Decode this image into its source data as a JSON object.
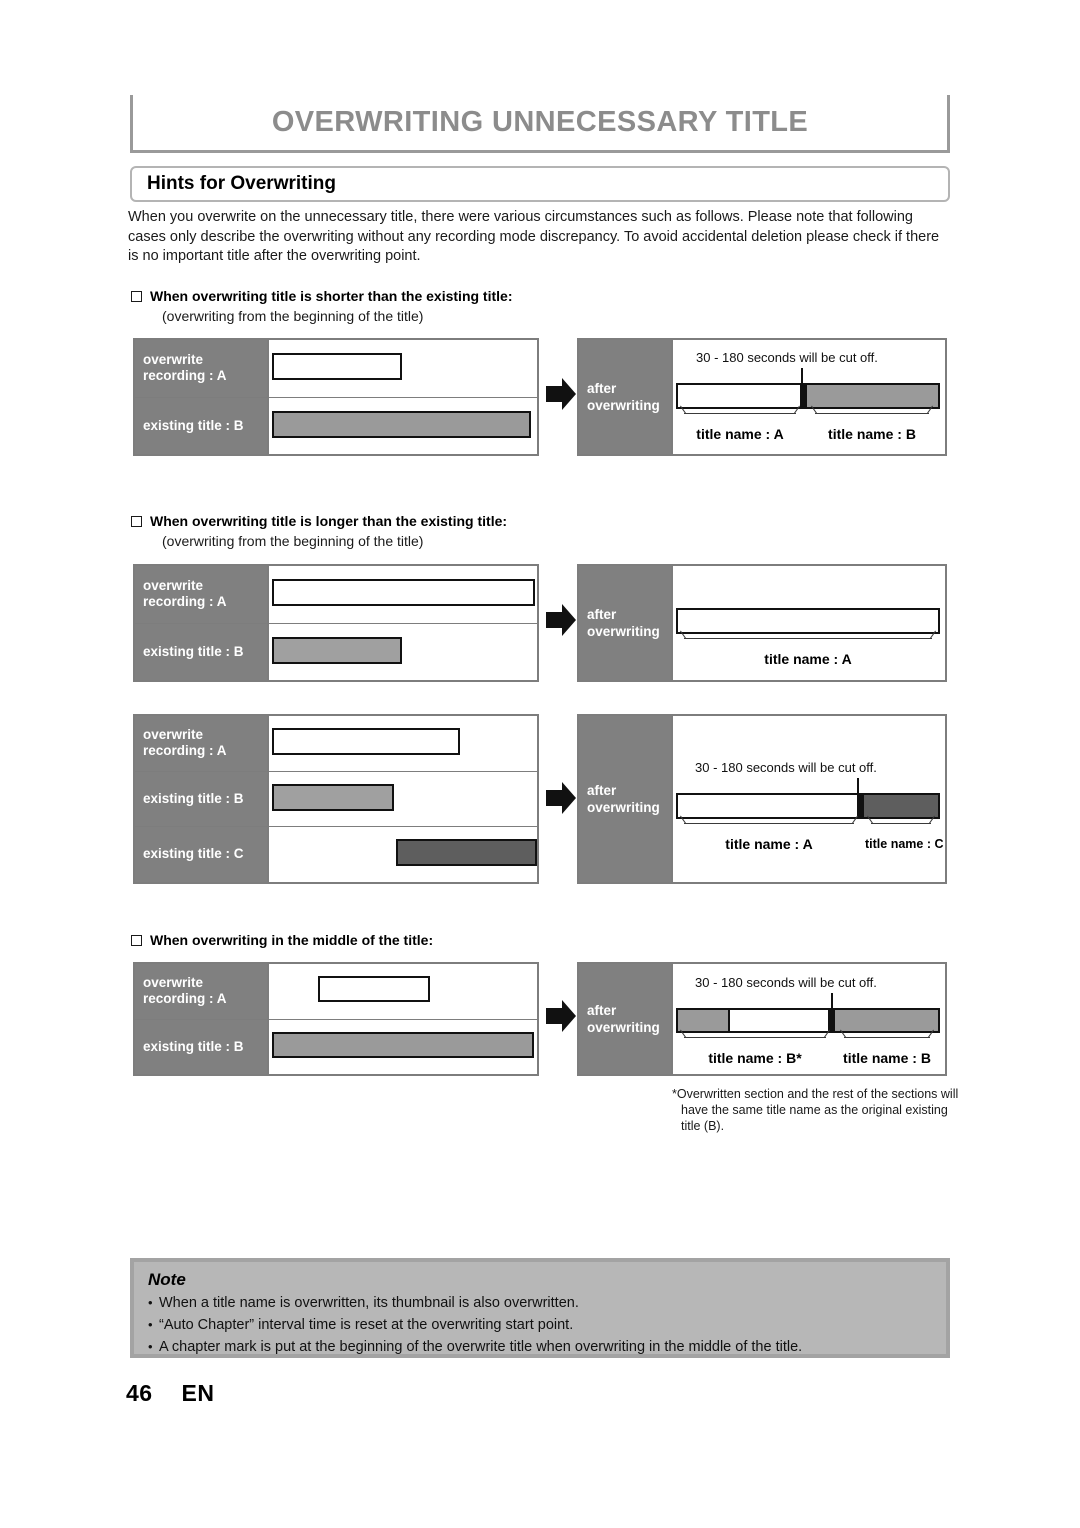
{
  "header": {
    "chapter_title": "OVERWRITING UNNECESSARY TITLE",
    "section_title": "Hints for Overwriting",
    "intro": "When you overwrite on the unnecessary title, there were various circumstances such as follows.  Please note that following cases only describe the overwriting without any recording mode discrepancy.  To avoid accidental deletion please check if there is no important title after the overwriting point."
  },
  "labels": {
    "overwrite_recording_a": "overwrite\nrecording : A",
    "overwrite_recording_a_l1": "overwrite",
    "overwrite_recording_a_l2": "recording : A",
    "existing_title_b": "existing title : B",
    "existing_title_c": "existing title : C",
    "after_l1": "after",
    "after_l2": "overwriting",
    "cutoff": "30 - 180 seconds will be cut off.",
    "title_name_a": "title name : A",
    "title_name_b": "title name : B",
    "title_name_c": "title name : C",
    "title_name_b_star": "title name : B*"
  },
  "sections": [
    {
      "heading": "When overwriting title is shorter than the existing title:",
      "subnote": "(overwriting from the beginning of the title)"
    },
    {
      "heading": "When overwriting title is longer than the existing title:",
      "subnote": "(overwriting from the beginning of the title)"
    },
    {
      "heading": "When overwriting in the middle of the title:",
      "subnote": ""
    }
  ],
  "footnote": {
    "line1": "*Overwritten section and the rest of the sections will",
    "line2": "have the same title name as the original existing",
    "line3": "title (B)."
  },
  "note": {
    "title": "Note",
    "bullet": "•",
    "items": [
      "When a title name is overwritten, its thumbnail is also overwritten.",
      "“Auto Chapter” interval time is reset at the overwriting start point.",
      "A chapter mark is put at the beginning of the overwrite title when overwriting in the middle of the title."
    ]
  },
  "footer": {
    "page_number": "46",
    "language": "EN"
  },
  "colors": {
    "label_gray": "#808080",
    "bar_light_gray": "#a0a0a0",
    "bar_mid_gray": "#9a9a9a",
    "bar_dark_gray": "#5e5e5e",
    "note_bg": "#b7b7b7",
    "title_gray": "#8c8c8c"
  }
}
